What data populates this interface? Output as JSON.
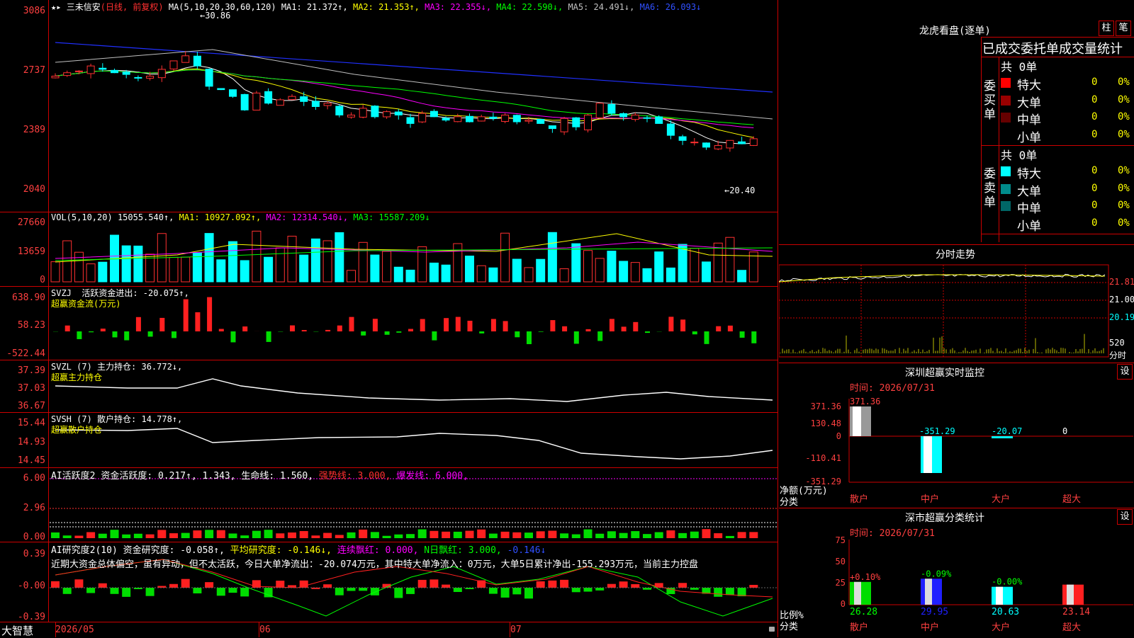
{
  "header": {
    "stock_name": "三未信安",
    "mode": "(日线, 前复权)",
    "ma_label": "MA(5,10,20,30,60,120)",
    "ma1": "MA1: 21.372↑,",
    "ma2": "MA2: 21.353↑,",
    "ma3": "MA3: 22.355↓,",
    "ma4": "MA4: 22.590↓,",
    "ma5": "MA5: 24.491↓,",
    "ma6": "MA6: 26.093↓"
  },
  "price_axis": [
    "3086",
    "2737",
    "2389",
    "2040"
  ],
  "price_marks": {
    "high": "30.86",
    "low": "20.40"
  },
  "vol": {
    "label": "VOL(5,10,20)",
    "value": "15055.540↑,",
    "ma1": "MA1: 10927.092↑,",
    "ma2": "MA2: 12314.540↓,",
    "ma3": "MA3: 15587.209↓",
    "axis": [
      "27660",
      "13659",
      "0"
    ]
  },
  "svzj": {
    "label": "SVZJ",
    "text": "活跃资金进出: -20.075↑,",
    "sub": "超赢资金流(万元)",
    "axis": [
      "638.90",
      "58.23",
      "-522.44"
    ]
  },
  "svzl": {
    "label": "SVZL (7)",
    "text": "主力持仓: 36.772↓,",
    "sub": "超赢主力持仓",
    "axis": [
      "37.39",
      "37.03",
      "36.67"
    ]
  },
  "svsh": {
    "label": "SVSH (7)",
    "text": "散户持仓: 14.778↑,",
    "sub": "超赢散户持仓",
    "axis": [
      "15.44",
      "14.93",
      "14.45"
    ]
  },
  "ai1": {
    "label": "AI活跃度2",
    "t1": "资金活跃度: 0.217↑,",
    "t2": "1.343,",
    "t3": "生命线: 1.560,",
    "t4": "强势线: 3.000,",
    "t5": "爆发线: 6.000,",
    "axis": [
      "6.00",
      "2.96",
      "0.00"
    ]
  },
  "ai2": {
    "label": "AI研究度2(10)",
    "t1": "资金研究度: -0.058↑,",
    "t2": "平均研究度: -0.146↓,",
    "t3": "连续飘红: 0.000,",
    "t4": "N日飘红: 3.000,",
    "t5": "-0.146↓",
    "comment": "近期大资金总体偏空，虽有异动，但不太活跃，今日大单净流出：-20.074万元，其中特大单净流入：0万元，大单5日累计净出-155.293万元，当前主力控盘",
    "axis": [
      "0.39",
      "-0.00",
      "-0.39"
    ]
  },
  "date_axis": {
    "brand": "大智慧",
    "d1": "2026/05",
    "d2": "06",
    "d3": "07"
  },
  "right": {
    "title": "龙虎看盘(逐单)",
    "btn_column": "柱",
    "btn_stroke": "笔",
    "stats_title": "已成交委托单成交量统计",
    "buy_side": "委买单",
    "sell_side": "委卖单",
    "buy_total": "共 0单",
    "sell_total": "共 0单",
    "buy_rows": [
      {
        "name": "特大",
        "n": "0",
        "p": "0%",
        "color": "#ff0000"
      },
      {
        "name": "大单",
        "n": "0",
        "p": "0%",
        "color": "#990000"
      },
      {
        "name": "中单",
        "n": "0",
        "p": "0%",
        "color": "#660000"
      },
      {
        "name": "小单",
        "n": "0",
        "p": "0%",
        "color": "#000000"
      }
    ],
    "sell_rows": [
      {
        "name": "特大",
        "n": "0",
        "p": "0%",
        "color": "#00ffff"
      },
      {
        "name": "大单",
        "n": "0",
        "p": "0%",
        "color": "#008b8b"
      },
      {
        "name": "中单",
        "n": "0",
        "p": "0%",
        "color": "#006666"
      },
      {
        "name": "小单",
        "n": "0",
        "p": "0%",
        "color": "#000000"
      }
    ],
    "intraday_title": "分时走势",
    "intraday_axis": [
      "21.81",
      "21.00",
      "20.19"
    ],
    "intraday_vol": "520",
    "intraday_vol_label": "分时",
    "sz_title": "深圳超赢实时监控",
    "sz_btn": "设",
    "sz_time": "时间: 2026/07/31",
    "sz_axis": [
      "371.36",
      "130.48",
      "0",
      "-110.41",
      "-351.29"
    ],
    "sz_values": {
      "sanhu": "371.36",
      "zhonghu": "-351.29",
      "dahu": "-20.07",
      "chaoda": "0"
    },
    "sz_ylabel": "净额(万元)",
    "sz_xlabel": "分类",
    "cats": [
      "散户",
      "中户",
      "大户",
      "超大"
    ],
    "ss_title": "深市超赢分类统计",
    "ss_btn": "设",
    "ss_time": "时间: 2026/07/31",
    "ss_axis": [
      "75",
      "50",
      "25",
      "0"
    ],
    "ss_top": [
      "+0.10%",
      "-0.09%",
      "-0.00%",
      ""
    ],
    "ss_bottom": [
      "26.28",
      "29.95",
      "20.63",
      "23.14"
    ],
    "ss_ylabel": "比例%",
    "ss_xlabel": "分类"
  }
}
